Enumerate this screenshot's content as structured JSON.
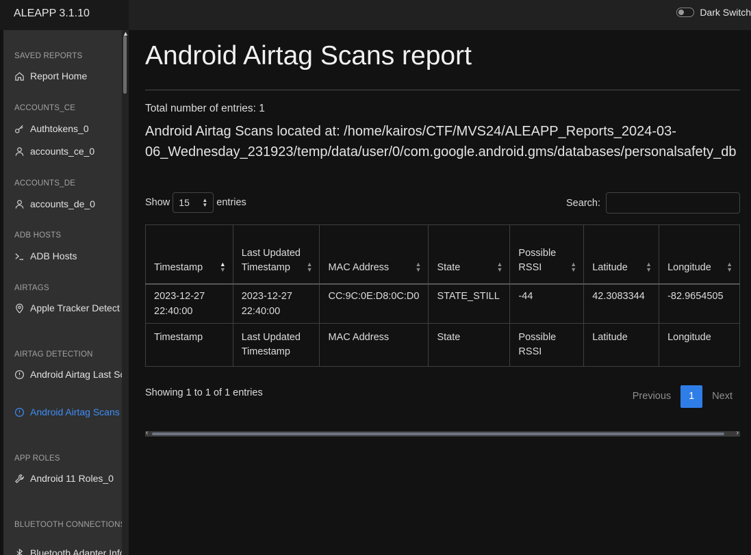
{
  "app": {
    "title": "ALEAPP 3.1.10"
  },
  "header": {
    "dark_switch_label": "Dark Switch"
  },
  "sidebar": {
    "sections": [
      {
        "title": "SAVED REPORTS",
        "items": [
          {
            "label": "Report Home",
            "icon": "home-icon"
          }
        ]
      },
      {
        "title": "ACCOUNTS_CE",
        "items": [
          {
            "label": "Authtokens_0",
            "icon": "key-icon"
          },
          {
            "label": "accounts_ce_0",
            "icon": "user-icon"
          }
        ]
      },
      {
        "title": "ACCOUNTS_DE",
        "items": [
          {
            "label": "accounts_de_0",
            "icon": "user-icon"
          }
        ]
      },
      {
        "title": "ADB HOSTS",
        "items": [
          {
            "label": "ADB Hosts",
            "icon": "terminal-icon"
          }
        ]
      },
      {
        "title": "AIRTAGS",
        "items": [
          {
            "label": "Apple Tracker Detect",
            "icon": "map-pin-icon"
          }
        ]
      },
      {
        "title": "AIRTAG DETECTION",
        "items": [
          {
            "label": "Android Airtag Last Scan",
            "icon": "alert-circle-icon"
          },
          {
            "label": "Android Airtag Scans",
            "icon": "alert-circle-icon",
            "active": true
          }
        ]
      },
      {
        "title": "APP ROLES",
        "items": [
          {
            "label": "Android 11 Roles_0",
            "icon": "tool-icon"
          }
        ]
      },
      {
        "title": "BLUETOOTH CONNECTIONS",
        "items": [
          {
            "label": "Bluetooth Adapter Info",
            "icon": "bluetooth-icon"
          }
        ]
      }
    ]
  },
  "main": {
    "title": "Android Airtag Scans report",
    "total_entries": "Total number of entries: 1",
    "location": "Android Airtag Scans located at: /home/kairos/CTF/MVS24/ALEAPP_Reports_2024-03-06_Wednesday_231923/temp/data/user/0/com.google.android.gms/databases/personalsafety_db",
    "show_label": "Show",
    "entries_label": "entries",
    "page_length": "15",
    "search_label": "Search:",
    "search_value": "",
    "table": {
      "headers": [
        "Timestamp",
        "Last Updated Timestamp",
        "MAC Address",
        "State",
        "Possible RSSI",
        "Latitude",
        "Longitude"
      ],
      "rows": [
        [
          "2023-12-27 22:40:00",
          "2023-12-27 22:40:00",
          "CC:9C:0E:D8:0C:D0",
          "STATE_STILL",
          "-44",
          "42.3083344",
          "-82.9654505"
        ]
      ],
      "footer": [
        "Timestamp",
        "Last Updated Timestamp",
        "MAC Address",
        "State",
        "Possible RSSI",
        "Latitude",
        "Longitude"
      ]
    },
    "showing": "Showing 1 to 1 of 1 entries",
    "pagination": {
      "previous": "Previous",
      "current": "1",
      "next": "Next"
    }
  },
  "colors": {
    "accent": "#2f7ee8",
    "active_link": "#3e8df7",
    "background": "#121212",
    "sidebar": "#303030",
    "topbar": "#212121"
  }
}
